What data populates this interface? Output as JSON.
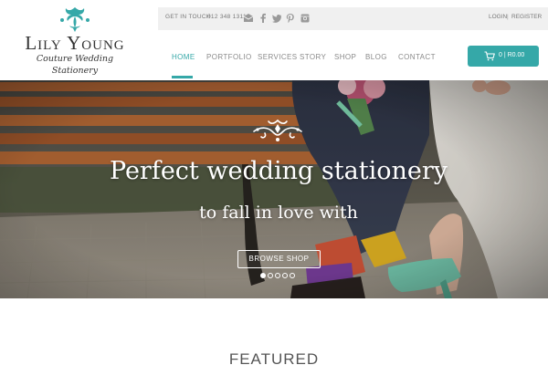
{
  "logo": {
    "name": "Lily Young",
    "tagline": "Couture Wedding Stationery",
    "mark_color": "#35a8a8"
  },
  "topbar": {
    "get_in_touch": "GET IN TOUCH",
    "phone": "012 348 1311",
    "social_icons": [
      "mail-icon",
      "facebook-icon",
      "twitter-icon",
      "pinterest-icon",
      "instagram-icon"
    ],
    "login": "LOGIN",
    "separator": "|",
    "register": "REGISTER"
  },
  "nav": {
    "items": [
      {
        "label": "HOME",
        "active": true
      },
      {
        "label": "PORTFOLIO",
        "active": false
      },
      {
        "label": "SERVICES",
        "active": false
      },
      {
        "label": "STORY",
        "active": false
      },
      {
        "label": "SHOP",
        "active": false
      },
      {
        "label": "BLOG",
        "active": false
      },
      {
        "label": "CONTACT",
        "active": false
      }
    ]
  },
  "cart": {
    "icon": "cart-icon",
    "summary": "0 | R0.00"
  },
  "hero": {
    "title": "Perfect wedding stationery",
    "subtitle": "to fall in love with",
    "button": "BROWSE SHOP",
    "slides_total": 5,
    "active_slide": 1
  },
  "featured": {
    "heading": "FEATURED"
  },
  "colors": {
    "accent": "#35a8a8",
    "topbar_bg": "#f0f0f0",
    "text_muted": "#8a8a8a"
  }
}
